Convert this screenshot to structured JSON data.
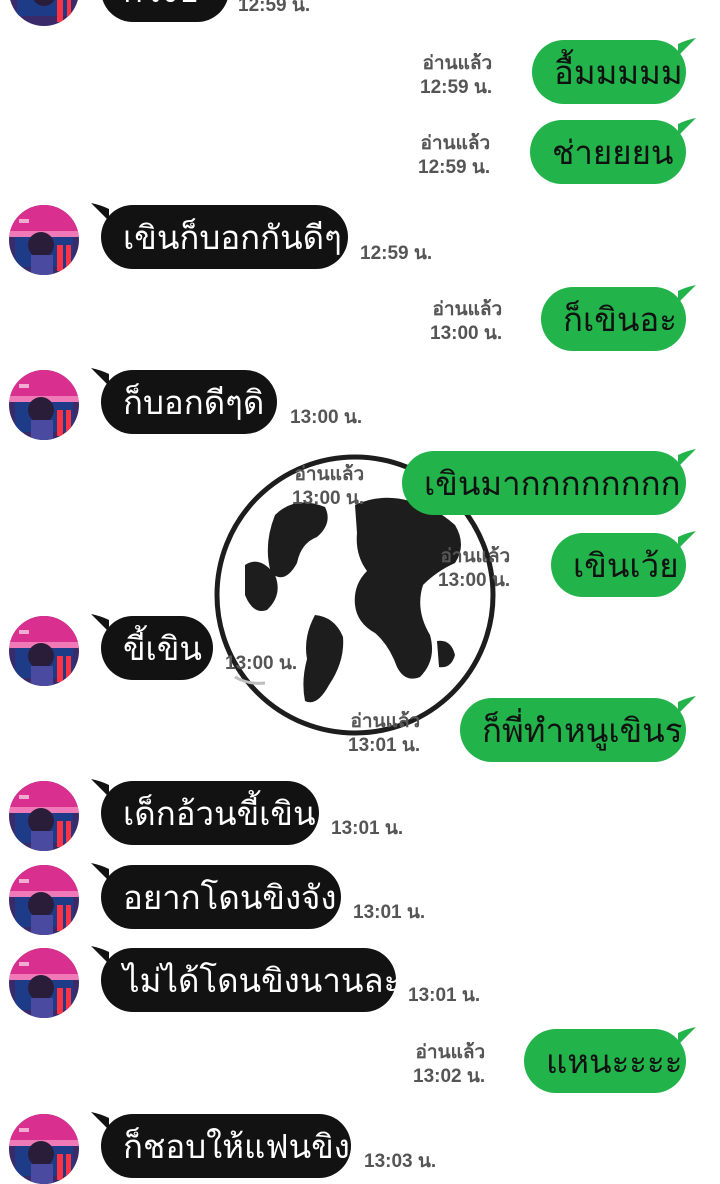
{
  "top_partial": {
    "text": "ก็ว่งบ",
    "time": "12:59 น."
  },
  "messages": [
    {
      "dir": "out",
      "text": "อื้มมมมม",
      "read": "อ่านแล้ว",
      "time": "12:59 น."
    },
    {
      "dir": "out",
      "text": "ช่ายยยน",
      "read": "อ่านแล้ว",
      "time": "12:59 น."
    },
    {
      "dir": "in",
      "text": "เขินก็บอกกันดีๆ",
      "time": "12:59 น."
    },
    {
      "dir": "out",
      "text": "ก็เขินอะ",
      "read": "อ่านแล้ว",
      "time": "13:00 น."
    },
    {
      "dir": "in",
      "text": "ก็บอกดีๆดิ",
      "time": "13:00 น."
    },
    {
      "dir": "out",
      "text": "เขินมากกกกกกกก",
      "read": "อ่านแล้ว",
      "time": "13:00 น."
    },
    {
      "dir": "out",
      "text": "เขินเว้ย",
      "read": "อ่านแล้ว",
      "time": "13:00 น."
    },
    {
      "dir": "in",
      "text": "ขี้เขิน",
      "time": "13:00 น."
    },
    {
      "dir": "out",
      "text": "ก็พี่ทำหนูเขินร",
      "read": "อ่านแล้ว",
      "time": "13:01 น."
    },
    {
      "dir": "in",
      "text": "เด็กอ้วนขี้เขิน",
      "time": "13:01 น."
    },
    {
      "dir": "in",
      "text": "อยากโดนขิงจัง",
      "time": "13:01 น."
    },
    {
      "dir": "in",
      "text": "ไม่ได้โดนขิงนานละ",
      "time": "13:01 น."
    },
    {
      "dir": "out",
      "text": "แหนะะะะ",
      "read": "อ่านแล้ว",
      "time": "13:02 น."
    },
    {
      "dir": "in",
      "text": "ก็ชอบให้แฟนขิง",
      "time": "13:03 น."
    }
  ],
  "colors": {
    "incoming_bubble": "#121212",
    "outgoing_bubble": "#22b34a",
    "meta_text": "#555555"
  },
  "icons": {
    "avatar": "avatar-image",
    "watermark": "globe-icon"
  }
}
